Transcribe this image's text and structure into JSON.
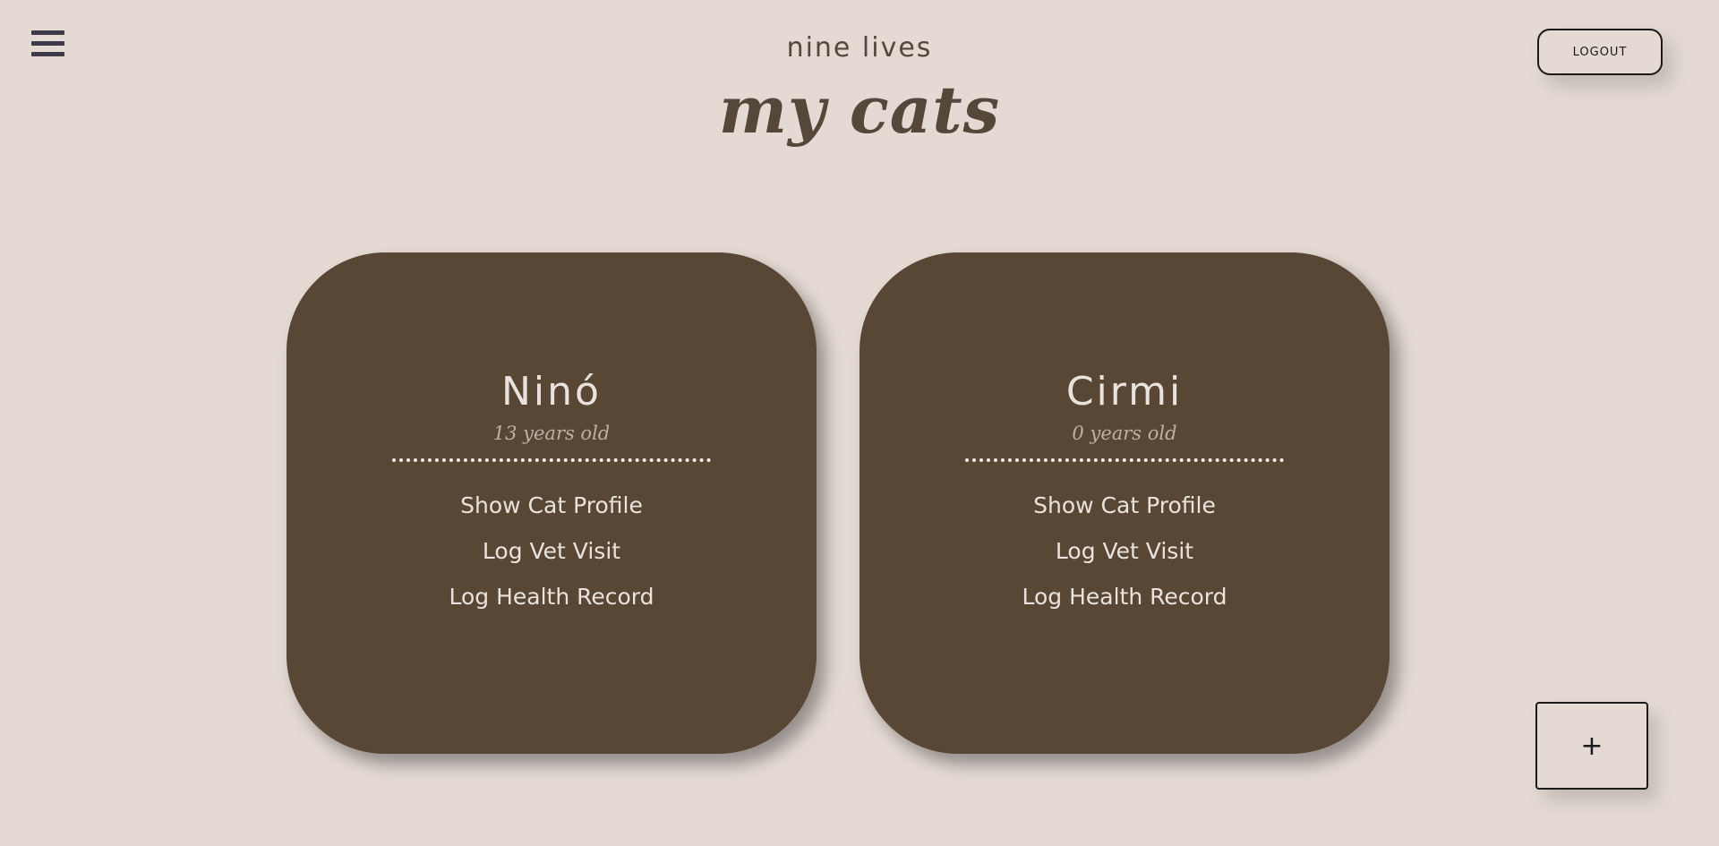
{
  "header": {
    "brand": "nine lives",
    "title": "my cats",
    "logout_label": "LOGOUT",
    "menu_icon": "hamburger-menu-icon"
  },
  "cats": [
    {
      "name": "Ninó",
      "age": "13 years old",
      "links": [
        "Show Cat Profile",
        "Log Vet Visit",
        "Log Health Record"
      ]
    },
    {
      "name": "Cirmi",
      "age": "0 years old",
      "links": [
        "Show Cat Profile",
        "Log Vet Visit",
        "Log Health Record"
      ]
    }
  ],
  "add_button": {
    "label": "+"
  },
  "colors": {
    "background": "#e4d9d3",
    "card": "#584735",
    "heading": "#55473a",
    "card_text": "#eae2dc",
    "muted": "#bdb0a4"
  }
}
